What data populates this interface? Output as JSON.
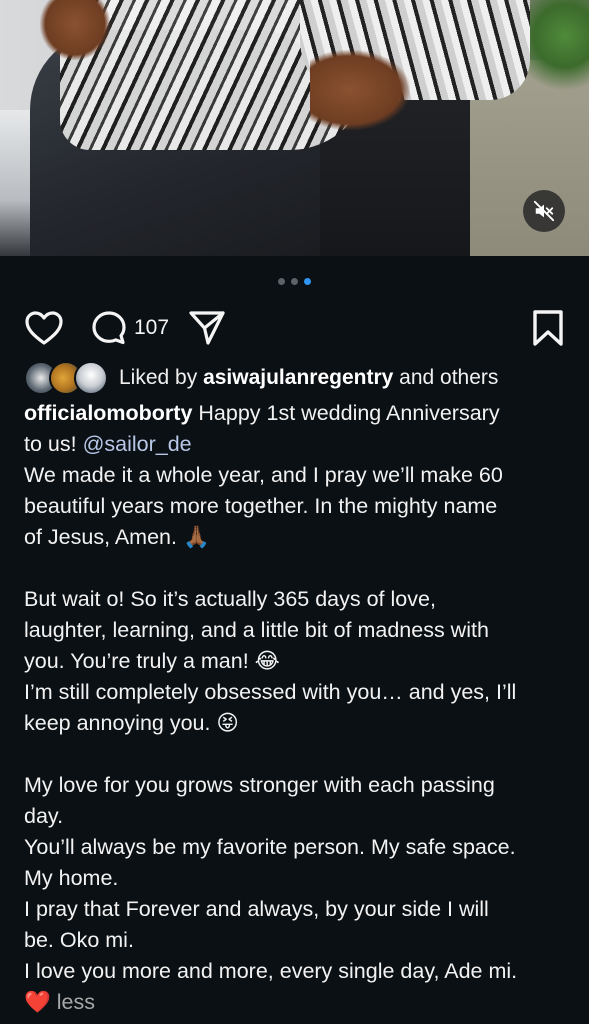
{
  "media": {
    "carousel": {
      "count": 3,
      "active_index": 2
    },
    "mute_icon": "speaker-muted-icon"
  },
  "actions": {
    "like_icon": "heart-outline-icon",
    "comment_icon": "comment-bubble-icon",
    "comment_count": "107",
    "share_icon": "paper-plane-icon",
    "save_icon": "bookmark-icon"
  },
  "likes": {
    "prefix": "Liked by",
    "user": "asiwajulanregentry",
    "suffix": "and others"
  },
  "caption": {
    "username": "officialomoborty",
    "line1_rest": " Happy 1st wedding Anniversary",
    "line2_text": "to us! ",
    "mention": "@sailor_de",
    "line3": "We made it a whole year, and I pray we’ll make 60",
    "line4": "beautiful years more together. In the mighty name",
    "line5": "of Jesus, Amen. 🙏🏾",
    "line6": "But wait o! So it’s actually 365 days of love,",
    "line7": "laughter, learning, and a little bit of madness with",
    "line8": "you. You’re truly a man! 😂",
    "line9": "I’m still completely obsessed with you… and yes, I’ll",
    "line10": "keep annoying you. 😝",
    "line11": "My love for you grows stronger with each passing",
    "line12": "day.",
    "line13": "You’ll always be my favorite person. My safe space.",
    "line14": "My home.",
    "line15": "I pray that Forever and always, by your side I will",
    "line16": "be. Oko mi.",
    "line17": "I love you more and more, every single day, Ade mi.",
    "heart": "❤️",
    "less": "less"
  },
  "colors": {
    "background": "#0b1014",
    "active_dot": "#2f95f5",
    "mention": "#b9c7e8",
    "muted_text": "#a8a8a8"
  }
}
